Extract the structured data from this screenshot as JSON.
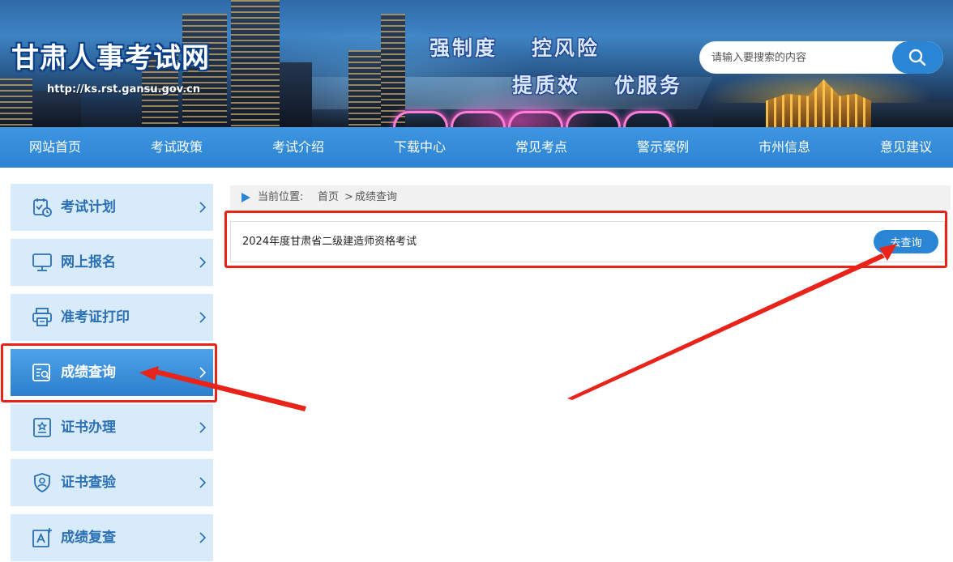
{
  "header": {
    "site_title": "甘肃人事考试网",
    "site_url": "http://ks.rst.gansu.gov.cn",
    "slogan_line1_a": "强制度",
    "slogan_line1_b": "控风险",
    "slogan_line2_a": "提质效",
    "slogan_line2_b": "优服务",
    "search": {
      "placeholder": "请输入要搜索的内容",
      "value": ""
    }
  },
  "nav": {
    "items": [
      "网站首页",
      "考试政策",
      "考试介绍",
      "下载中心",
      "常见考点",
      "警示案例",
      "市州信息",
      "意见建议"
    ]
  },
  "sidebar": {
    "items": [
      {
        "label": "考试计划",
        "icon": "calendar-clock-icon",
        "active": false
      },
      {
        "label": "网上报名",
        "icon": "monitor-icon",
        "active": false
      },
      {
        "label": "准考证打印",
        "icon": "printer-icon",
        "active": false
      },
      {
        "label": "成绩查询",
        "icon": "search-document-icon",
        "active": true
      },
      {
        "label": "证书办理",
        "icon": "certificate-icon",
        "active": false
      },
      {
        "label": "证书查验",
        "icon": "shield-user-icon",
        "active": false
      },
      {
        "label": "成绩复查",
        "icon": "text-recheck-icon",
        "active": false
      }
    ]
  },
  "breadcrumb": {
    "label": "当前位置:",
    "home": "首页",
    "separator": ">",
    "current": "成绩查询"
  },
  "results": [
    {
      "title": "2024年度甘肃省二级建造师资格考试",
      "action": "去查询"
    }
  ],
  "colors": {
    "primary": "#2a86d4",
    "sidebar_bg": "#d8ebfa",
    "sidebar_text": "#2b6fb4",
    "annotation": "#e8231a"
  }
}
